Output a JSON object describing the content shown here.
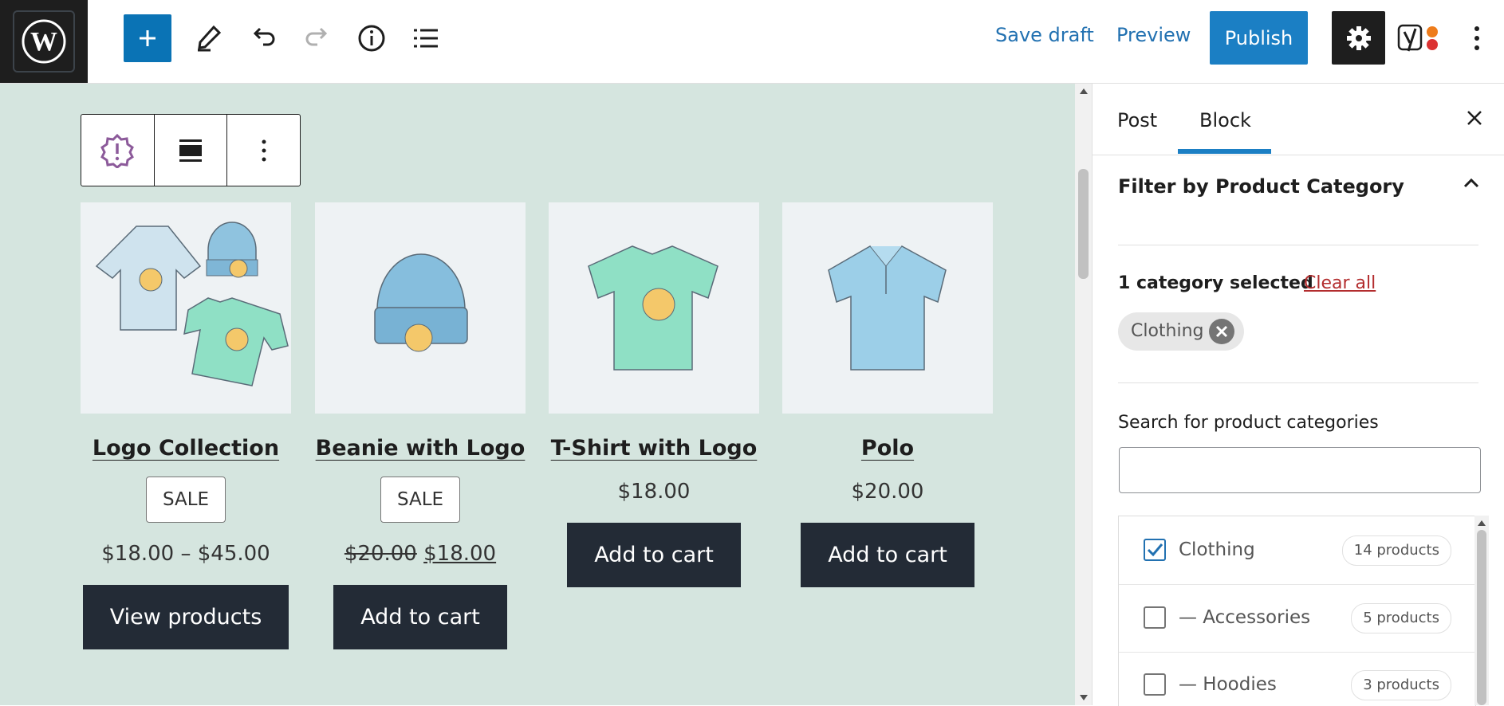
{
  "toolbar": {
    "save_draft": "Save draft",
    "preview": "Preview",
    "publish": "Publish"
  },
  "products": [
    {
      "title": "Logo Collection",
      "badge": "SALE",
      "price": "$18.00 – $45.00",
      "button": "View products",
      "image": "hoodie-beanie-tshirt"
    },
    {
      "title": "Beanie with Logo",
      "badge": "SALE",
      "price_old": "$20.00",
      "price_new": "$18.00",
      "button": "Add to cart",
      "image": "beanie"
    },
    {
      "title": "T-Shirt with Logo",
      "price": "$18.00",
      "button": "Add to cart",
      "image": "tshirt"
    },
    {
      "title": "Polo",
      "price": "$20.00",
      "button": "Add to cart",
      "image": "polo"
    }
  ],
  "sidebar": {
    "tabs": [
      "Post",
      "Block"
    ],
    "active_tab": "Block",
    "panel_title": "Filter by Product Category",
    "selected_count": "1 category selected",
    "clear_all": "Clear all",
    "chip": "Clothing",
    "search_label": "Search for product categories",
    "search_value": "",
    "categories": [
      {
        "label": "Clothing",
        "count": "14 products",
        "checked": true
      },
      {
        "label": "— Accessories",
        "count": "5 products",
        "checked": false
      },
      {
        "label": "— Hoodies",
        "count": "3 products",
        "checked": false
      }
    ]
  },
  "colors": {
    "accent": "#1b7fc4",
    "canvas_bg": "#d5e5df",
    "button_dark": "#232b36",
    "clear_all": "#b32d2e"
  }
}
